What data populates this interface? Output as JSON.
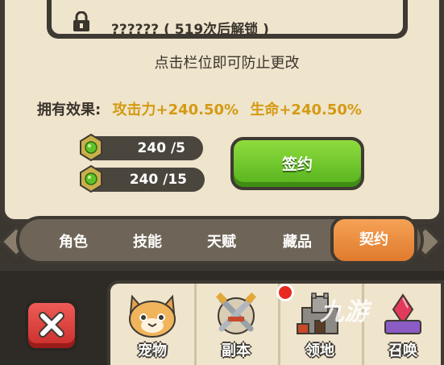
{
  "lock": {
    "text": "?????? ( 519次后解锁 )",
    "icon": "lock-icon"
  },
  "hint": "点击栏位即可防止更改",
  "effects": {
    "label": "拥有效果:",
    "attack": "攻击力+240.50%",
    "life": "生命+240.50%"
  },
  "costs": [
    {
      "amount": "240 /5",
      "icon": "green-gem-icon"
    },
    {
      "amount": "240 /15",
      "icon": "green-gem-icon"
    }
  ],
  "sign_button": "签约",
  "tabs": [
    {
      "label": "角色"
    },
    {
      "label": "技能"
    },
    {
      "label": "天赋"
    },
    {
      "label": "藏品"
    },
    {
      "label": "契约",
      "active": true
    }
  ],
  "bottom_nav": [
    {
      "label": "宠物",
      "icon": "cat-icon"
    },
    {
      "label": "副本",
      "icon": "crossed-swords-icon"
    },
    {
      "label": "领地",
      "icon": "castle-icon"
    },
    {
      "label": "召唤",
      "icon": "summon-icon"
    }
  ],
  "watermark": "九游",
  "colors": {
    "accent_orange": "#e88a3a",
    "green": "#6cc42a",
    "gold_text": "#d49a12",
    "panel": "#efe4cc"
  }
}
